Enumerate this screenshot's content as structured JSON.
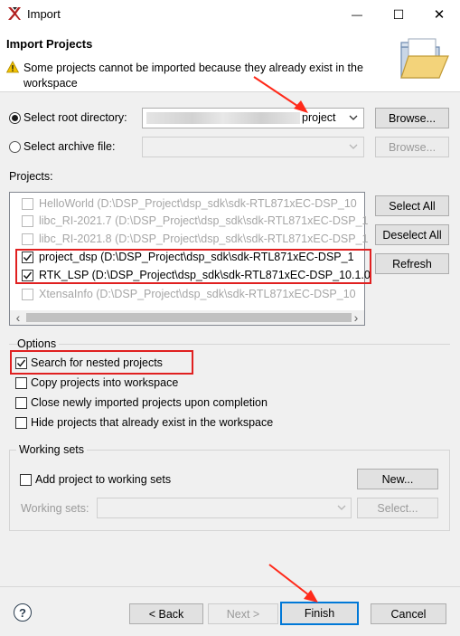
{
  "window": {
    "title": "Import",
    "minimize_glyph": "—",
    "maximize_glyph": "☐",
    "close_glyph": "✕"
  },
  "banner": {
    "title": "Import Projects",
    "message": "Some projects cannot be imported because they already exist in the workspace",
    "icon": "folder-icon",
    "warning_icon": "warning-icon"
  },
  "source": {
    "root_directory": {
      "label": "Select root directory:",
      "selected": true,
      "value": "project"
    },
    "archive_file": {
      "label": "Select archive file:",
      "selected": false,
      "value": ""
    },
    "browse_label": "Browse..."
  },
  "projects": {
    "label": "Projects:",
    "items": [
      {
        "label": "HelloWorld (D:\\DSP_Project\\dsp_sdk\\sdk-RTL871xEC-DSP_10",
        "checked": false,
        "disabled": true
      },
      {
        "label": "libc_RI-2021.7 (D:\\DSP_Project\\dsp_sdk\\sdk-RTL871xEC-DSP_1",
        "checked": false,
        "disabled": true
      },
      {
        "label": "libc_RI-2021.8 (D:\\DSP_Project\\dsp_sdk\\sdk-RTL871xEC-DSP_1",
        "checked": false,
        "disabled": true
      },
      {
        "label": "project_dsp (D:\\DSP_Project\\dsp_sdk\\sdk-RTL871xEC-DSP_1",
        "checked": true,
        "disabled": false
      },
      {
        "label": "RTK_LSP (D:\\DSP_Project\\dsp_sdk\\sdk-RTL871xEC-DSP_10.1.0",
        "checked": true,
        "disabled": false
      },
      {
        "label": "XtensaInfo (D:\\DSP_Project\\dsp_sdk\\sdk-RTL871xEC-DSP_10",
        "checked": false,
        "disabled": true
      }
    ],
    "select_all": "Select All",
    "deselect_all": "Deselect All",
    "refresh": "Refresh",
    "scroll_left_glyph": "‹",
    "scroll_right_glyph": "›"
  },
  "options": {
    "label": "Options",
    "items": [
      {
        "label": "Search for nested projects",
        "checked": true
      },
      {
        "label": "Copy projects into workspace",
        "checked": false
      },
      {
        "label": "Close newly imported projects upon completion",
        "checked": false
      },
      {
        "label": "Hide projects that already exist in the workspace",
        "checked": false
      }
    ]
  },
  "working_sets": {
    "label": "Working sets",
    "add_label": "Add project to working sets",
    "add_checked": false,
    "new_label": "New...",
    "sets_label": "Working sets:",
    "select_label": "Select..."
  },
  "footer": {
    "help_glyph": "?",
    "back": "< Back",
    "next": "Next >",
    "finish": "Finish",
    "cancel": "Cancel"
  },
  "colors": {
    "highlight": "#e02020",
    "arrow": "#ff2a1a",
    "focus": "#0078d7"
  }
}
